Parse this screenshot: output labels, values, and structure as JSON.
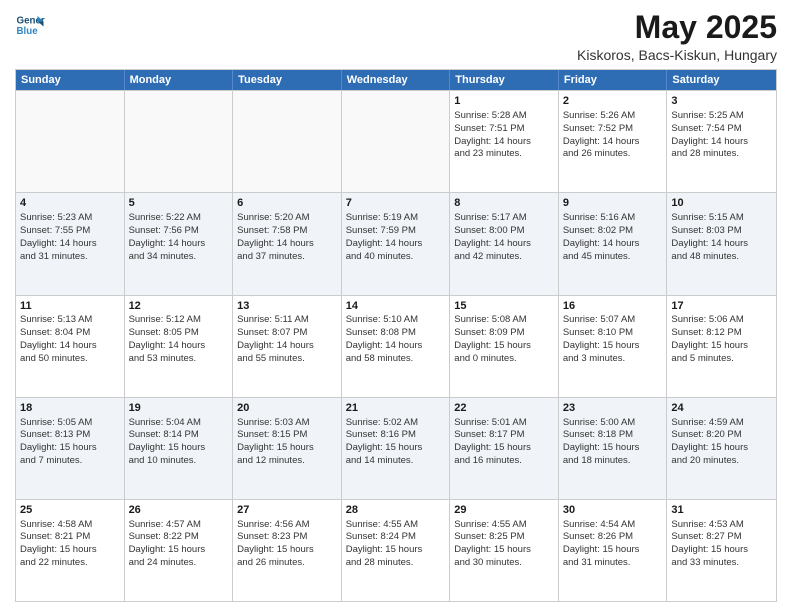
{
  "header": {
    "logo_line1": "General",
    "logo_line2": "Blue",
    "title": "May 2025",
    "subtitle": "Kiskoros, Bacs-Kiskun, Hungary"
  },
  "weekdays": [
    "Sunday",
    "Monday",
    "Tuesday",
    "Wednesday",
    "Thursday",
    "Friday",
    "Saturday"
  ],
  "rows": [
    [
      {
        "day": "",
        "empty": true
      },
      {
        "day": "",
        "empty": true
      },
      {
        "day": "",
        "empty": true
      },
      {
        "day": "",
        "empty": true
      },
      {
        "day": "1",
        "line1": "Sunrise: 5:28 AM",
        "line2": "Sunset: 7:51 PM",
        "line3": "Daylight: 14 hours",
        "line4": "and 23 minutes."
      },
      {
        "day": "2",
        "line1": "Sunrise: 5:26 AM",
        "line2": "Sunset: 7:52 PM",
        "line3": "Daylight: 14 hours",
        "line4": "and 26 minutes."
      },
      {
        "day": "3",
        "line1": "Sunrise: 5:25 AM",
        "line2": "Sunset: 7:54 PM",
        "line3": "Daylight: 14 hours",
        "line4": "and 28 minutes."
      }
    ],
    [
      {
        "day": "4",
        "line1": "Sunrise: 5:23 AM",
        "line2": "Sunset: 7:55 PM",
        "line3": "Daylight: 14 hours",
        "line4": "and 31 minutes."
      },
      {
        "day": "5",
        "line1": "Sunrise: 5:22 AM",
        "line2": "Sunset: 7:56 PM",
        "line3": "Daylight: 14 hours",
        "line4": "and 34 minutes."
      },
      {
        "day": "6",
        "line1": "Sunrise: 5:20 AM",
        "line2": "Sunset: 7:58 PM",
        "line3": "Daylight: 14 hours",
        "line4": "and 37 minutes."
      },
      {
        "day": "7",
        "line1": "Sunrise: 5:19 AM",
        "line2": "Sunset: 7:59 PM",
        "line3": "Daylight: 14 hours",
        "line4": "and 40 minutes."
      },
      {
        "day": "8",
        "line1": "Sunrise: 5:17 AM",
        "line2": "Sunset: 8:00 PM",
        "line3": "Daylight: 14 hours",
        "line4": "and 42 minutes."
      },
      {
        "day": "9",
        "line1": "Sunrise: 5:16 AM",
        "line2": "Sunset: 8:02 PM",
        "line3": "Daylight: 14 hours",
        "line4": "and 45 minutes."
      },
      {
        "day": "10",
        "line1": "Sunrise: 5:15 AM",
        "line2": "Sunset: 8:03 PM",
        "line3": "Daylight: 14 hours",
        "line4": "and 48 minutes."
      }
    ],
    [
      {
        "day": "11",
        "line1": "Sunrise: 5:13 AM",
        "line2": "Sunset: 8:04 PM",
        "line3": "Daylight: 14 hours",
        "line4": "and 50 minutes."
      },
      {
        "day": "12",
        "line1": "Sunrise: 5:12 AM",
        "line2": "Sunset: 8:05 PM",
        "line3": "Daylight: 14 hours",
        "line4": "and 53 minutes."
      },
      {
        "day": "13",
        "line1": "Sunrise: 5:11 AM",
        "line2": "Sunset: 8:07 PM",
        "line3": "Daylight: 14 hours",
        "line4": "and 55 minutes."
      },
      {
        "day": "14",
        "line1": "Sunrise: 5:10 AM",
        "line2": "Sunset: 8:08 PM",
        "line3": "Daylight: 14 hours",
        "line4": "and 58 minutes."
      },
      {
        "day": "15",
        "line1": "Sunrise: 5:08 AM",
        "line2": "Sunset: 8:09 PM",
        "line3": "Daylight: 15 hours",
        "line4": "and 0 minutes."
      },
      {
        "day": "16",
        "line1": "Sunrise: 5:07 AM",
        "line2": "Sunset: 8:10 PM",
        "line3": "Daylight: 15 hours",
        "line4": "and 3 minutes."
      },
      {
        "day": "17",
        "line1": "Sunrise: 5:06 AM",
        "line2": "Sunset: 8:12 PM",
        "line3": "Daylight: 15 hours",
        "line4": "and 5 minutes."
      }
    ],
    [
      {
        "day": "18",
        "line1": "Sunrise: 5:05 AM",
        "line2": "Sunset: 8:13 PM",
        "line3": "Daylight: 15 hours",
        "line4": "and 7 minutes."
      },
      {
        "day": "19",
        "line1": "Sunrise: 5:04 AM",
        "line2": "Sunset: 8:14 PM",
        "line3": "Daylight: 15 hours",
        "line4": "and 10 minutes."
      },
      {
        "day": "20",
        "line1": "Sunrise: 5:03 AM",
        "line2": "Sunset: 8:15 PM",
        "line3": "Daylight: 15 hours",
        "line4": "and 12 minutes."
      },
      {
        "day": "21",
        "line1": "Sunrise: 5:02 AM",
        "line2": "Sunset: 8:16 PM",
        "line3": "Daylight: 15 hours",
        "line4": "and 14 minutes."
      },
      {
        "day": "22",
        "line1": "Sunrise: 5:01 AM",
        "line2": "Sunset: 8:17 PM",
        "line3": "Daylight: 15 hours",
        "line4": "and 16 minutes."
      },
      {
        "day": "23",
        "line1": "Sunrise: 5:00 AM",
        "line2": "Sunset: 8:18 PM",
        "line3": "Daylight: 15 hours",
        "line4": "and 18 minutes."
      },
      {
        "day": "24",
        "line1": "Sunrise: 4:59 AM",
        "line2": "Sunset: 8:20 PM",
        "line3": "Daylight: 15 hours",
        "line4": "and 20 minutes."
      }
    ],
    [
      {
        "day": "25",
        "line1": "Sunrise: 4:58 AM",
        "line2": "Sunset: 8:21 PM",
        "line3": "Daylight: 15 hours",
        "line4": "and 22 minutes."
      },
      {
        "day": "26",
        "line1": "Sunrise: 4:57 AM",
        "line2": "Sunset: 8:22 PM",
        "line3": "Daylight: 15 hours",
        "line4": "and 24 minutes."
      },
      {
        "day": "27",
        "line1": "Sunrise: 4:56 AM",
        "line2": "Sunset: 8:23 PM",
        "line3": "Daylight: 15 hours",
        "line4": "and 26 minutes."
      },
      {
        "day": "28",
        "line1": "Sunrise: 4:55 AM",
        "line2": "Sunset: 8:24 PM",
        "line3": "Daylight: 15 hours",
        "line4": "and 28 minutes."
      },
      {
        "day": "29",
        "line1": "Sunrise: 4:55 AM",
        "line2": "Sunset: 8:25 PM",
        "line3": "Daylight: 15 hours",
        "line4": "and 30 minutes."
      },
      {
        "day": "30",
        "line1": "Sunrise: 4:54 AM",
        "line2": "Sunset: 8:26 PM",
        "line3": "Daylight: 15 hours",
        "line4": "and 31 minutes."
      },
      {
        "day": "31",
        "line1": "Sunrise: 4:53 AM",
        "line2": "Sunset: 8:27 PM",
        "line3": "Daylight: 15 hours",
        "line4": "and 33 minutes."
      }
    ]
  ]
}
